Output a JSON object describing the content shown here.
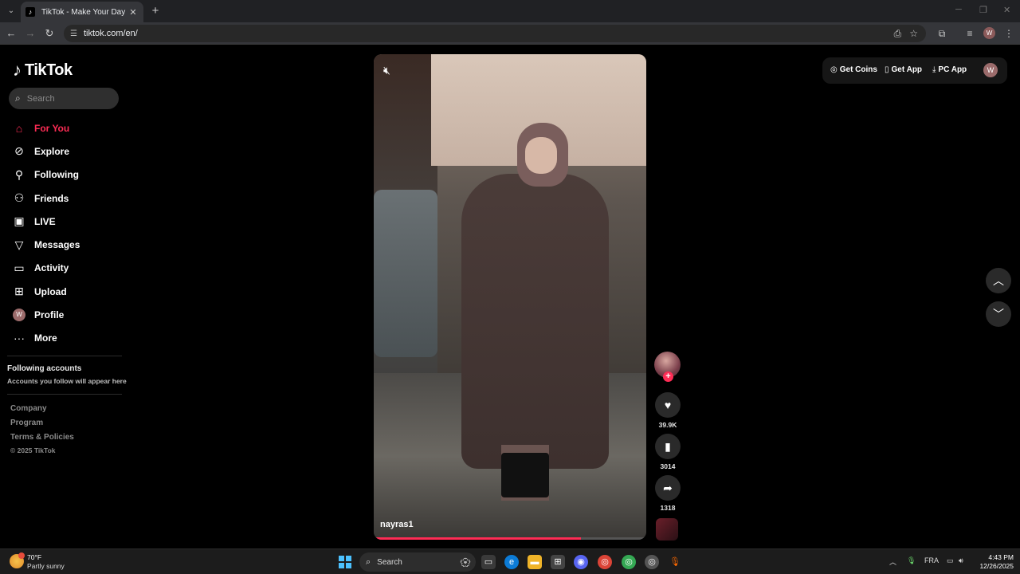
{
  "browser": {
    "tab_title": "TikTok - Make Your Day",
    "url": "tiktok.com/en/",
    "profile_initial": "W"
  },
  "sidebar": {
    "logo": "TikTok",
    "search_placeholder": "Search",
    "nav": [
      {
        "label": "For You",
        "icon": "home-icon"
      },
      {
        "label": "Explore",
        "icon": "compass-icon"
      },
      {
        "label": "Following",
        "icon": "following-icon"
      },
      {
        "label": "Friends",
        "icon": "friends-icon"
      },
      {
        "label": "LIVE",
        "icon": "live-icon"
      },
      {
        "label": "Messages",
        "icon": "messages-icon"
      },
      {
        "label": "Activity",
        "icon": "activity-icon"
      },
      {
        "label": "Upload",
        "icon": "upload-icon"
      },
      {
        "label": "Profile",
        "icon": "avatar"
      },
      {
        "label": "More",
        "icon": "more-icon"
      }
    ],
    "following_accounts_title": "Following accounts",
    "following_accounts_sub": "Accounts you follow will appear here",
    "footer_links": [
      "Company",
      "Program",
      "Terms & Policies"
    ],
    "copyright": "© 2025 TikTok",
    "profile_initial": "W"
  },
  "video": {
    "username": "nayras1",
    "progress": 0.76
  },
  "actions": {
    "likes": "39.9K",
    "saves": "3014",
    "shares": "1318"
  },
  "top_actions": {
    "get_coins": "Get Coins",
    "get_app": "Get App",
    "pc_app": "PC App",
    "profile_initial": "W"
  },
  "taskbar": {
    "temp": "70°F",
    "weather": "Partly sunny",
    "search": "Search",
    "lang": "FRA",
    "time": "4:43 PM",
    "date": "12/26/2025"
  },
  "colors": {
    "accent": "#fe2c55",
    "background": "#000000"
  }
}
